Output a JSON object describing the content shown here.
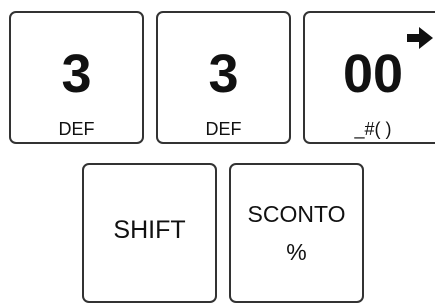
{
  "keypad": {
    "row1": [
      {
        "digit": "3",
        "sub": "DEF"
      },
      {
        "digit": "3",
        "sub": "DEF"
      },
      {
        "digit": "00",
        "sub": "_#( )",
        "icon": "arrow-right-icon"
      }
    ],
    "row2": [
      {
        "label": "SHIFT"
      },
      {
        "label_line1": "SCONTO",
        "label_line2": "%"
      }
    ]
  }
}
